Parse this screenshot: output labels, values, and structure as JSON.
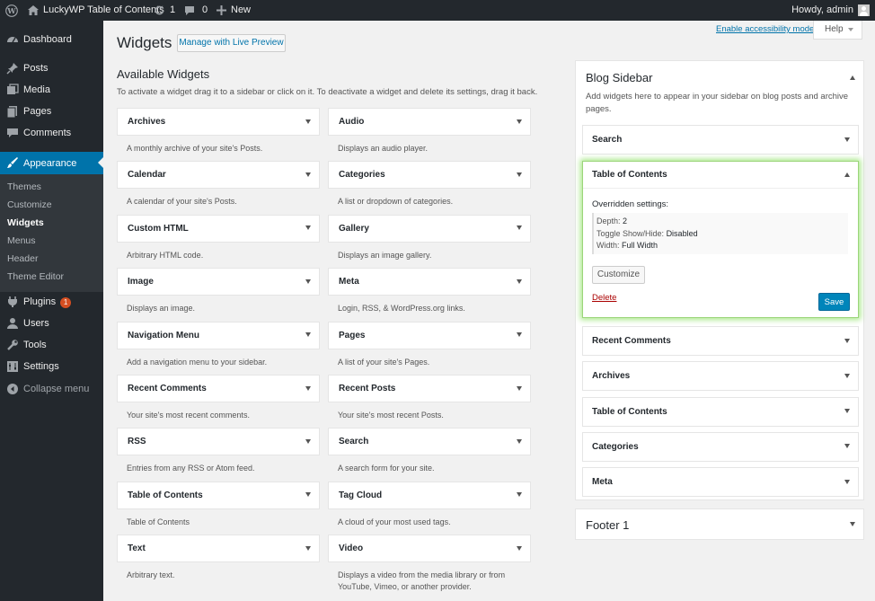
{
  "adminbar": {
    "site_name": "LuckyWP Table of Contents",
    "updates_count": "1",
    "comments_count": "0",
    "new_label": "New",
    "howdy": "Howdy, admin"
  },
  "menu": {
    "dashboard": "Dashboard",
    "posts": "Posts",
    "media": "Media",
    "pages": "Pages",
    "comments": "Comments",
    "appearance": "Appearance",
    "submenu": [
      "Themes",
      "Customize",
      "Widgets",
      "Menus",
      "Header",
      "Theme Editor"
    ],
    "plugins": "Plugins",
    "plugins_badge": "1",
    "users": "Users",
    "tools": "Tools",
    "settings": "Settings",
    "collapse": "Collapse menu"
  },
  "header": {
    "title": "Widgets",
    "live_preview": "Manage with Live Preview",
    "accessibility": "Enable accessibility mode",
    "help": "Help"
  },
  "available": {
    "title": "Available Widgets",
    "intro": "To activate a widget drag it to a sidebar or click on it. To deactivate a widget and delete its settings, drag it back.",
    "widgets": [
      {
        "name": "Archives",
        "desc": "A monthly archive of your site's Posts."
      },
      {
        "name": "Audio",
        "desc": "Displays an audio player."
      },
      {
        "name": "Calendar",
        "desc": "A calendar of your site's Posts."
      },
      {
        "name": "Categories",
        "desc": "A list or dropdown of categories."
      },
      {
        "name": "Custom HTML",
        "desc": "Arbitrary HTML code."
      },
      {
        "name": "Gallery",
        "desc": "Displays an image gallery."
      },
      {
        "name": "Image",
        "desc": "Displays an image."
      },
      {
        "name": "Meta",
        "desc": "Login, RSS, & WordPress.org links."
      },
      {
        "name": "Navigation Menu",
        "desc": "Add a navigation menu to your sidebar."
      },
      {
        "name": "Pages",
        "desc": "A list of your site's Pages."
      },
      {
        "name": "Recent Comments",
        "desc": "Your site's most recent comments."
      },
      {
        "name": "Recent Posts",
        "desc": "Your site's most recent Posts."
      },
      {
        "name": "RSS",
        "desc": "Entries from any RSS or Atom feed."
      },
      {
        "name": "Search",
        "desc": "A search form for your site."
      },
      {
        "name": "Table of Contents",
        "desc": "Table of Contents"
      },
      {
        "name": "Tag Cloud",
        "desc": "A cloud of your most used tags."
      },
      {
        "name": "Text",
        "desc": "Arbitrary text."
      },
      {
        "name": "Video",
        "desc": "Displays a video from the media library or from YouTube, Vimeo, or another provider."
      }
    ]
  },
  "blog_sidebar": {
    "title": "Blog Sidebar",
    "desc": "Add widgets here to appear in your sidebar on blog posts and archive pages.",
    "search": "Search",
    "toc": {
      "title": "Table of Contents",
      "overridden_label": "Overridden settings:",
      "depth_label": "Depth:",
      "depth_value": "2",
      "toggle_label": "Toggle Show/Hide:",
      "toggle_value": "Disabled",
      "width_label": "Width:",
      "width_value": "Full Width",
      "customize": "Customize",
      "delete": "Delete",
      "save": "Save"
    },
    "after": [
      "Recent Comments",
      "Archives",
      "Table of Contents",
      "Categories",
      "Meta"
    ]
  },
  "footer_sidebar": {
    "title": "Footer 1"
  },
  "colors": {
    "admin_dark": "#23282d",
    "accent": "#0073aa",
    "highlight_glow": "#7ad03a",
    "delete_red": "#a00"
  }
}
